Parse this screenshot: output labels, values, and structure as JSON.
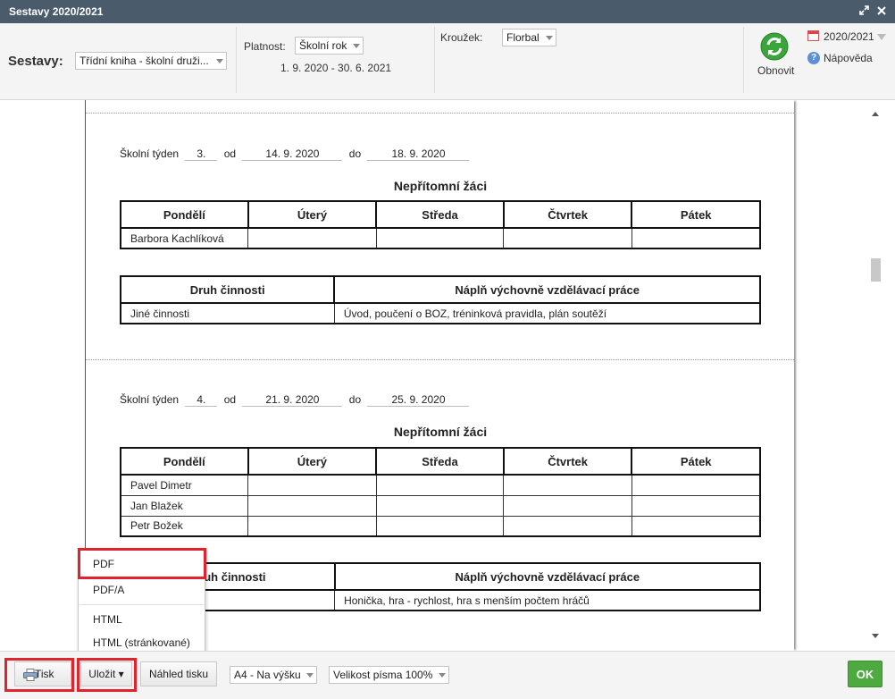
{
  "window": {
    "title": "Sestavy 2020/2021",
    "expand_icon": "expand-icon",
    "close_icon": "close-icon"
  },
  "toolbar": {
    "sestavy_label": "Sestavy:",
    "sestavy_value": "Třídní kniha - školní druži...",
    "platnost_label": "Platnost:",
    "platnost_value": "Školní rok",
    "platnost_range": "1. 9. 2020 - 30. 6. 2021",
    "krouzek_label": "Kroužek:",
    "krouzek_value": "Florbal",
    "obnovit_label": "Obnovit",
    "year_label": "2020/2021",
    "help_label": "Nápověda",
    "help_glyph": "?"
  },
  "report": {
    "week_label": "Školní týden",
    "od_label": "od",
    "do_label": "do",
    "absent_title": "Nepřítomní žáci",
    "days": [
      "Pondělí",
      "Úterý",
      "Středa",
      "Čtvrtek",
      "Pátek"
    ],
    "activity_headers": [
      "Druh činnosti",
      "Náplň výchovně vzdělávací práce"
    ],
    "weeks": [
      {
        "number": "3.",
        "from": "14. 9. 2020",
        "to": "18. 9. 2020",
        "absent": [
          "Barbora Kachlíková"
        ],
        "activity_type": "Jiné činnosti",
        "activity_content": "Úvod, poučení o BOZ, tréninková pravidla, plán soutěží"
      },
      {
        "number": "4.",
        "from": "21. 9. 2020",
        "to": "25. 9. 2020",
        "absent": [
          "Pavel Dimetr",
          "Jan Blažek",
          "Petr Božek"
        ],
        "activity_header_visible": "uh činnosti",
        "activity_content": "Honička, hra - rychlost, hra s menším počtem hráčů"
      }
    ]
  },
  "save_menu": {
    "items": [
      "PDF",
      "PDF/A",
      "HTML",
      "HTML (stránkované)"
    ]
  },
  "footer": {
    "print_label": "Tisk",
    "save_label": "Uložit",
    "save_caret": "▾",
    "preview_label": "Náhled tisku",
    "paper_value": "A4 - Na výšku",
    "font_value": "Velikost písma 100%",
    "ok_label": "OK"
  },
  "colors": {
    "titlebar": "#4a5b6c",
    "ok": "#4caa3f",
    "highlight": "#e0232c",
    "refresh": "#3aa53a"
  }
}
